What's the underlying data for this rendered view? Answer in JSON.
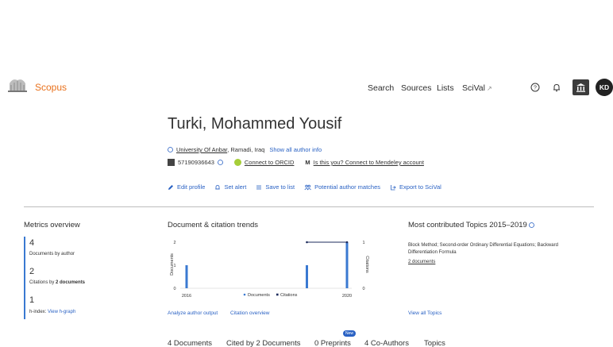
{
  "header": {
    "brand": "Scopus",
    "nav": {
      "search": "Search",
      "sources": "Sources",
      "lists": "Lists",
      "scival": "SciVal",
      "scival_ext": "↗"
    },
    "avatar_initials": "KD"
  },
  "author": {
    "name": "Turki, Mohammed Yousif",
    "affiliation": "University Of Anbar",
    "location": ", Ramadi, Iraq",
    "show_all_info": "Show all author info",
    "scopus_id": "57190936643",
    "connect_orcid": "Connect to ORCID",
    "mendeley_prefix": "M",
    "mendeley": "Is this you? Connect to Mendeley account"
  },
  "actions": {
    "edit": "Edit profile",
    "alert": "Set alert",
    "save": "Save to list",
    "matches": "Potential author matches",
    "export": "Export to SciVal"
  },
  "metrics": {
    "title": "Metrics overview",
    "documents": "4",
    "documents_label": "Documents by author",
    "citations": "2",
    "citations_label_prefix": "Citations by ",
    "citations_label_bold": "2 documents",
    "hindex": "1",
    "hindex_label": "h-index:",
    "hindex_link": "View h-graph"
  },
  "trends": {
    "title": "Document & citation trends",
    "analyze_link": "Analyze author output",
    "citation_link": "Citation overview"
  },
  "chart_data": {
    "type": "bar",
    "x_ticks": [
      "2016",
      "2020"
    ],
    "y_left_label": "Documents",
    "y_right_label": "Citations",
    "y_left_ticks": [
      "2",
      "1",
      "0"
    ],
    "y_right_ticks": [
      "1",
      "0"
    ],
    "series": [
      {
        "name": "Documents",
        "type": "bar",
        "x": [
          "2016",
          "2019",
          "2020"
        ],
        "values": [
          1,
          1,
          2
        ]
      },
      {
        "name": "Citations",
        "type": "line",
        "x": [
          "2019",
          "2020"
        ],
        "values": [
          1,
          1
        ]
      }
    ],
    "legend": [
      "Documents",
      "Citations"
    ],
    "colors": {
      "documents": "#3a79d1",
      "citations": "#1d2b5c"
    }
  },
  "topics": {
    "title": "Most contributed Topics 2015–2019",
    "topic": "Block Method; Second-order Ordinary Differential Equations; Backward Differentiation Formula",
    "docs": "2 documents",
    "view_all": "View all Topics"
  },
  "tabs": {
    "documents": "4 Documents",
    "cited_by": "Cited by 2 Documents",
    "preprints": "0 Preprints",
    "new_badge": "New",
    "coauthors": "4 Co-Authors",
    "topics": "Topics"
  }
}
